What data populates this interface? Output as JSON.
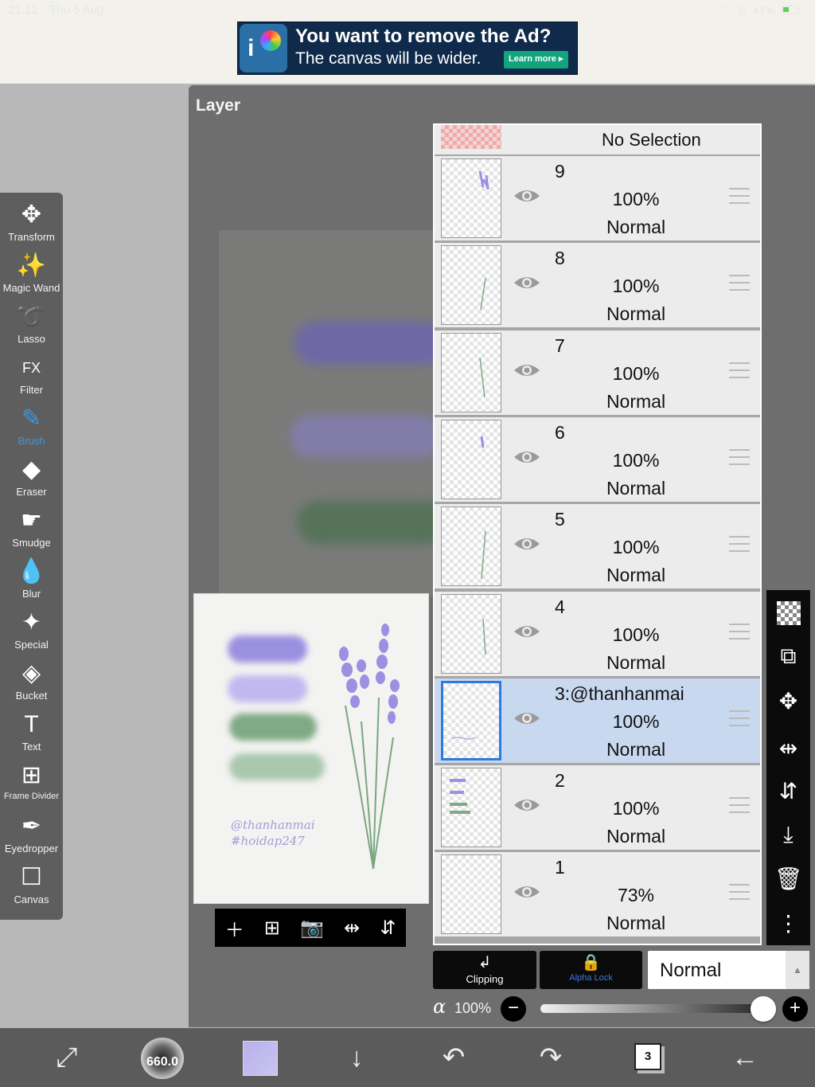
{
  "status": {
    "time": "21:12",
    "date": "Thu 5 Aug",
    "battery": "41%"
  },
  "ad": {
    "title": "You want to remove the Ad?",
    "subtitle": "The canvas will be wider.",
    "learn_more": "Learn more ▸"
  },
  "toolbar": {
    "tools": [
      {
        "label": "Transform",
        "icon": "✥"
      },
      {
        "label": "Magic Wand",
        "icon": "✨"
      },
      {
        "label": "Lasso",
        "icon": "➰"
      },
      {
        "label": "Filter",
        "icon": "FX"
      },
      {
        "label": "Brush",
        "icon": "✎"
      },
      {
        "label": "Eraser",
        "icon": "◆"
      },
      {
        "label": "Smudge",
        "icon": "☛"
      },
      {
        "label": "Blur",
        "icon": "💧"
      },
      {
        "label": "Special",
        "icon": "✦"
      },
      {
        "label": "Bucket",
        "icon": "◈"
      },
      {
        "label": "Text",
        "icon": "T"
      },
      {
        "label": "Frame Divider",
        "icon": "⊞"
      },
      {
        "label": "Eyedropper",
        "icon": "✒"
      },
      {
        "label": "Canvas",
        "icon": "☐"
      }
    ],
    "active": "Brush",
    "active_color": "#3d97e0"
  },
  "panel": {
    "title": "Layer"
  },
  "thumbnail": {
    "signature": "@thanhanmai\n#hoidap247"
  },
  "layers": {
    "no_selection": "No Selection",
    "rows": [
      {
        "name": "9",
        "opacity": "100%",
        "blend": "Normal"
      },
      {
        "name": "8",
        "opacity": "100%",
        "blend": "Normal"
      },
      {
        "name": "7",
        "opacity": "100%",
        "blend": "Normal"
      },
      {
        "name": "6",
        "opacity": "100%",
        "blend": "Normal"
      },
      {
        "name": "5",
        "opacity": "100%",
        "blend": "Normal"
      },
      {
        "name": "4",
        "opacity": "100%",
        "blend": "Normal"
      },
      {
        "name": "3:@thanhanmai",
        "opacity": "100%",
        "blend": "Normal"
      },
      {
        "name": "2",
        "opacity": "100%",
        "blend": "Normal"
      },
      {
        "name": "1",
        "opacity": "73%",
        "blend": "Normal"
      }
    ],
    "selected": "3:@thanhanmai",
    "selected_color": "#c8d8ef"
  },
  "layer_controls": {
    "clipping": "Clipping",
    "alpha_lock": "Alpha Lock",
    "blend_mode": "Normal",
    "alpha_symbol": "α",
    "opacity_label": "100%",
    "opacity_value": 1.0
  },
  "bottom_bar": {
    "brush_size": "660.0",
    "color": "#c3bdf0",
    "layer_count": "3"
  }
}
